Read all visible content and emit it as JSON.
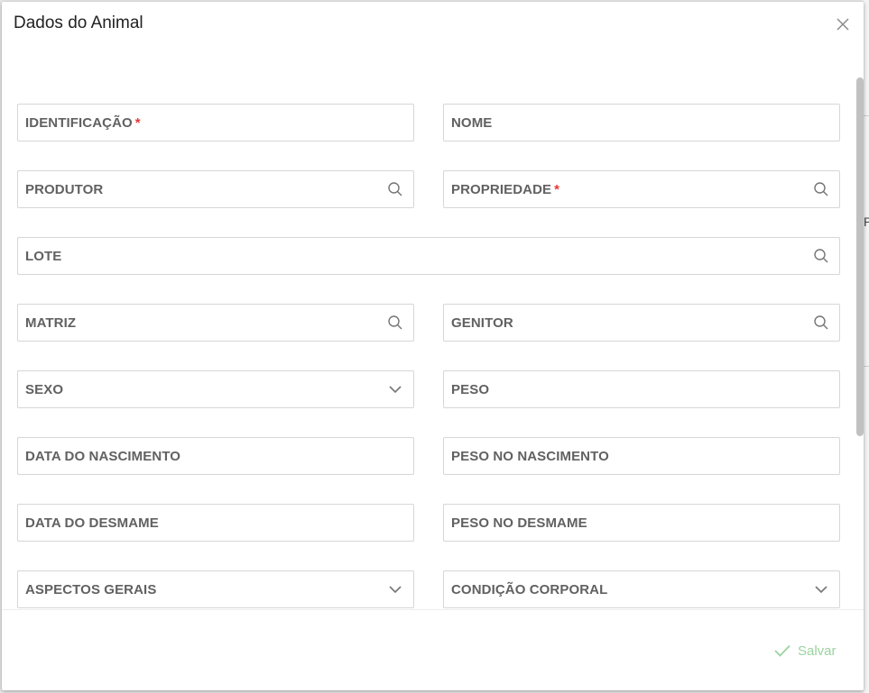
{
  "modal": {
    "title": "Dados do Animal",
    "required_marker": "*",
    "save_label": "Salvar"
  },
  "fields": {
    "identificacao": {
      "label": "IDENTIFICAÇÃO",
      "required": true
    },
    "nome": {
      "label": "NOME"
    },
    "produtor": {
      "label": "PRODUTOR",
      "icon": "search-icon"
    },
    "propriedade": {
      "label": "PROPRIEDADE",
      "required": true,
      "icon": "search-icon"
    },
    "lote": {
      "label": "LOTE",
      "icon": "search-icon"
    },
    "matriz": {
      "label": "MATRIZ",
      "icon": "search-icon"
    },
    "genitor": {
      "label": "GENITOR",
      "icon": "search-icon"
    },
    "sexo": {
      "label": "SEXO",
      "icon": "chevron-down-icon"
    },
    "peso": {
      "label": "PESO"
    },
    "data_nascimento": {
      "label": "DATA DO NASCIMENTO"
    },
    "peso_nascimento": {
      "label": "PESO NO NASCIMENTO"
    },
    "data_desmame": {
      "label": "DATA DO DESMAME"
    },
    "peso_desmame": {
      "label": "PESO NO DESMAME"
    },
    "aspectos_gerais": {
      "label": "ASPECTOS GERAIS",
      "icon": "chevron-down-icon"
    },
    "condicao_corporal": {
      "label": "CONDIÇÃO CORPORAL",
      "icon": "chevron-down-icon"
    }
  },
  "background": {
    "partial_text": "P"
  },
  "colors": {
    "required": "#e53935",
    "label": "#616161",
    "border": "#d6d6d6",
    "save_disabled": "#9bd3a1",
    "icon": "#757575"
  }
}
